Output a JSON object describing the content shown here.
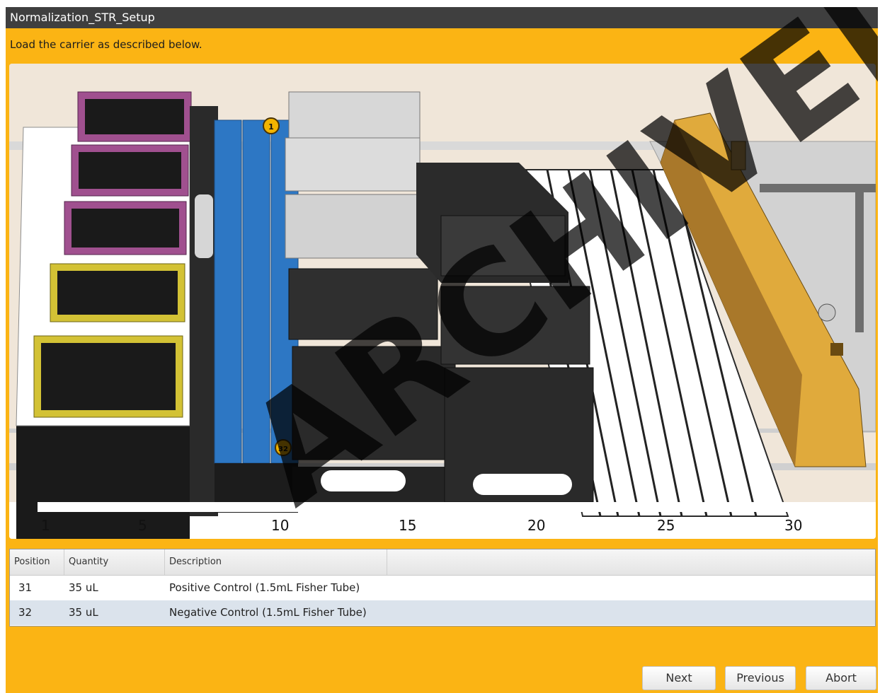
{
  "window": {
    "title": "Normalization_STR_Setup"
  },
  "instruction": "Load the carrier as described below.",
  "deck": {
    "ruler_labels": [
      "1",
      "5",
      "10",
      "15",
      "20",
      "25",
      "30"
    ],
    "markers": [
      "1",
      "32"
    ]
  },
  "table": {
    "headers": [
      "Position",
      "Quantity",
      "Description"
    ],
    "rows": [
      {
        "position": "31",
        "quantity": "35 uL",
        "description": "Positive Control (1.5mL Fisher Tube)"
      },
      {
        "position": "32",
        "quantity": "35 uL",
        "description": "Negative Control (1.5mL Fisher Tube)"
      }
    ]
  },
  "buttons": {
    "next": "Next",
    "previous": "Previous",
    "abort": "Abort"
  },
  "watermark": "ARCHIVED",
  "colors": {
    "background": "#fbb414",
    "titlebar": "#3f3f3f",
    "tube": "#3a8fd8",
    "rack_purple": "#a0508f",
    "rack_yellow": "#d3c235"
  }
}
